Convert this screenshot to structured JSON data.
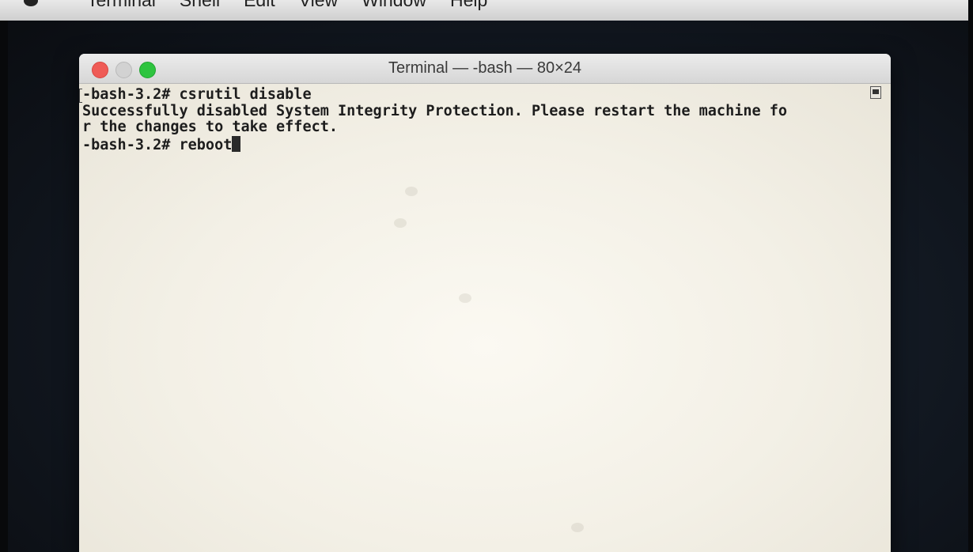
{
  "menubar": {
    "items": [
      "Terminal",
      "Shell",
      "Edit",
      "View",
      "Window",
      "Help"
    ]
  },
  "window": {
    "title": "Terminal — -bash — 80×24",
    "controls": {
      "close": "close-button",
      "minimize": "minimize-button",
      "zoom": "zoom-button"
    }
  },
  "terminal": {
    "lines": [
      "-bash-3.2# csrutil disable",
      "Successfully disabled System Integrity Protection. Please restart the machine fo",
      "r the changes to take effect.",
      "-bash-3.2# reboot"
    ]
  },
  "colors": {
    "terminal_bg": "#f3f0e6",
    "terminal_text": "#1d1d1d",
    "close": "#ef5b56",
    "minimize": "#d2d2d2",
    "zoom": "#2ec43f"
  }
}
